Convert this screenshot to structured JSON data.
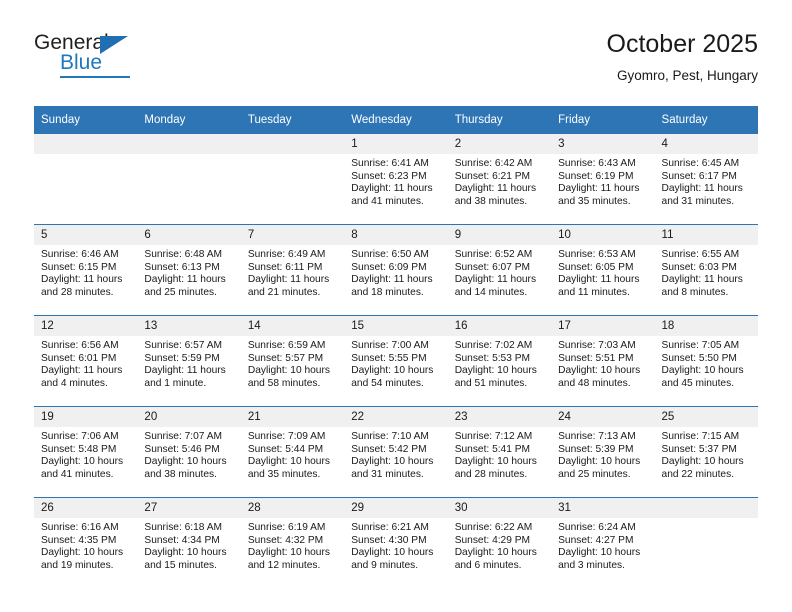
{
  "brand": {
    "name_top": "General",
    "name_bottom": "Blue",
    "accent_color": "#1f78bd",
    "triangle_color": "#1f6fb2"
  },
  "header": {
    "title": "October 2025",
    "location": "Gyomro, Pest, Hungary",
    "header_bg": "#2e75b6",
    "daynum_bg": "#f0f0f0"
  },
  "weekday_headers": [
    "Sunday",
    "Monday",
    "Tuesday",
    "Wednesday",
    "Thursday",
    "Friday",
    "Saturday"
  ],
  "weeks": [
    [
      {
        "day": "",
        "sunrise": "",
        "sunset": "",
        "daylight1": "",
        "daylight2": ""
      },
      {
        "day": "",
        "sunrise": "",
        "sunset": "",
        "daylight1": "",
        "daylight2": ""
      },
      {
        "day": "",
        "sunrise": "",
        "sunset": "",
        "daylight1": "",
        "daylight2": ""
      },
      {
        "day": "1",
        "sunrise": "Sunrise: 6:41 AM",
        "sunset": "Sunset: 6:23 PM",
        "daylight1": "Daylight: 11 hours",
        "daylight2": "and 41 minutes."
      },
      {
        "day": "2",
        "sunrise": "Sunrise: 6:42 AM",
        "sunset": "Sunset: 6:21 PM",
        "daylight1": "Daylight: 11 hours",
        "daylight2": "and 38 minutes."
      },
      {
        "day": "3",
        "sunrise": "Sunrise: 6:43 AM",
        "sunset": "Sunset: 6:19 PM",
        "daylight1": "Daylight: 11 hours",
        "daylight2": "and 35 minutes."
      },
      {
        "day": "4",
        "sunrise": "Sunrise: 6:45 AM",
        "sunset": "Sunset: 6:17 PM",
        "daylight1": "Daylight: 11 hours",
        "daylight2": "and 31 minutes."
      }
    ],
    [
      {
        "day": "5",
        "sunrise": "Sunrise: 6:46 AM",
        "sunset": "Sunset: 6:15 PM",
        "daylight1": "Daylight: 11 hours",
        "daylight2": "and 28 minutes."
      },
      {
        "day": "6",
        "sunrise": "Sunrise: 6:48 AM",
        "sunset": "Sunset: 6:13 PM",
        "daylight1": "Daylight: 11 hours",
        "daylight2": "and 25 minutes."
      },
      {
        "day": "7",
        "sunrise": "Sunrise: 6:49 AM",
        "sunset": "Sunset: 6:11 PM",
        "daylight1": "Daylight: 11 hours",
        "daylight2": "and 21 minutes."
      },
      {
        "day": "8",
        "sunrise": "Sunrise: 6:50 AM",
        "sunset": "Sunset: 6:09 PM",
        "daylight1": "Daylight: 11 hours",
        "daylight2": "and 18 minutes."
      },
      {
        "day": "9",
        "sunrise": "Sunrise: 6:52 AM",
        "sunset": "Sunset: 6:07 PM",
        "daylight1": "Daylight: 11 hours",
        "daylight2": "and 14 minutes."
      },
      {
        "day": "10",
        "sunrise": "Sunrise: 6:53 AM",
        "sunset": "Sunset: 6:05 PM",
        "daylight1": "Daylight: 11 hours",
        "daylight2": "and 11 minutes."
      },
      {
        "day": "11",
        "sunrise": "Sunrise: 6:55 AM",
        "sunset": "Sunset: 6:03 PM",
        "daylight1": "Daylight: 11 hours",
        "daylight2": "and 8 minutes."
      }
    ],
    [
      {
        "day": "12",
        "sunrise": "Sunrise: 6:56 AM",
        "sunset": "Sunset: 6:01 PM",
        "daylight1": "Daylight: 11 hours",
        "daylight2": "and 4 minutes."
      },
      {
        "day": "13",
        "sunrise": "Sunrise: 6:57 AM",
        "sunset": "Sunset: 5:59 PM",
        "daylight1": "Daylight: 11 hours",
        "daylight2": "and 1 minute."
      },
      {
        "day": "14",
        "sunrise": "Sunrise: 6:59 AM",
        "sunset": "Sunset: 5:57 PM",
        "daylight1": "Daylight: 10 hours",
        "daylight2": "and 58 minutes."
      },
      {
        "day": "15",
        "sunrise": "Sunrise: 7:00 AM",
        "sunset": "Sunset: 5:55 PM",
        "daylight1": "Daylight: 10 hours",
        "daylight2": "and 54 minutes."
      },
      {
        "day": "16",
        "sunrise": "Sunrise: 7:02 AM",
        "sunset": "Sunset: 5:53 PM",
        "daylight1": "Daylight: 10 hours",
        "daylight2": "and 51 minutes."
      },
      {
        "day": "17",
        "sunrise": "Sunrise: 7:03 AM",
        "sunset": "Sunset: 5:51 PM",
        "daylight1": "Daylight: 10 hours",
        "daylight2": "and 48 minutes."
      },
      {
        "day": "18",
        "sunrise": "Sunrise: 7:05 AM",
        "sunset": "Sunset: 5:50 PM",
        "daylight1": "Daylight: 10 hours",
        "daylight2": "and 45 minutes."
      }
    ],
    [
      {
        "day": "19",
        "sunrise": "Sunrise: 7:06 AM",
        "sunset": "Sunset: 5:48 PM",
        "daylight1": "Daylight: 10 hours",
        "daylight2": "and 41 minutes."
      },
      {
        "day": "20",
        "sunrise": "Sunrise: 7:07 AM",
        "sunset": "Sunset: 5:46 PM",
        "daylight1": "Daylight: 10 hours",
        "daylight2": "and 38 minutes."
      },
      {
        "day": "21",
        "sunrise": "Sunrise: 7:09 AM",
        "sunset": "Sunset: 5:44 PM",
        "daylight1": "Daylight: 10 hours",
        "daylight2": "and 35 minutes."
      },
      {
        "day": "22",
        "sunrise": "Sunrise: 7:10 AM",
        "sunset": "Sunset: 5:42 PM",
        "daylight1": "Daylight: 10 hours",
        "daylight2": "and 31 minutes."
      },
      {
        "day": "23",
        "sunrise": "Sunrise: 7:12 AM",
        "sunset": "Sunset: 5:41 PM",
        "daylight1": "Daylight: 10 hours",
        "daylight2": "and 28 minutes."
      },
      {
        "day": "24",
        "sunrise": "Sunrise: 7:13 AM",
        "sunset": "Sunset: 5:39 PM",
        "daylight1": "Daylight: 10 hours",
        "daylight2": "and 25 minutes."
      },
      {
        "day": "25",
        "sunrise": "Sunrise: 7:15 AM",
        "sunset": "Sunset: 5:37 PM",
        "daylight1": "Daylight: 10 hours",
        "daylight2": "and 22 minutes."
      }
    ],
    [
      {
        "day": "26",
        "sunrise": "Sunrise: 6:16 AM",
        "sunset": "Sunset: 4:35 PM",
        "daylight1": "Daylight: 10 hours",
        "daylight2": "and 19 minutes."
      },
      {
        "day": "27",
        "sunrise": "Sunrise: 6:18 AM",
        "sunset": "Sunset: 4:34 PM",
        "daylight1": "Daylight: 10 hours",
        "daylight2": "and 15 minutes."
      },
      {
        "day": "28",
        "sunrise": "Sunrise: 6:19 AM",
        "sunset": "Sunset: 4:32 PM",
        "daylight1": "Daylight: 10 hours",
        "daylight2": "and 12 minutes."
      },
      {
        "day": "29",
        "sunrise": "Sunrise: 6:21 AM",
        "sunset": "Sunset: 4:30 PM",
        "daylight1": "Daylight: 10 hours",
        "daylight2": "and 9 minutes."
      },
      {
        "day": "30",
        "sunrise": "Sunrise: 6:22 AM",
        "sunset": "Sunset: 4:29 PM",
        "daylight1": "Daylight: 10 hours",
        "daylight2": "and 6 minutes."
      },
      {
        "day": "31",
        "sunrise": "Sunrise: 6:24 AM",
        "sunset": "Sunset: 4:27 PM",
        "daylight1": "Daylight: 10 hours",
        "daylight2": "and 3 minutes."
      },
      {
        "day": "",
        "sunrise": "",
        "sunset": "",
        "daylight1": "",
        "daylight2": ""
      }
    ]
  ]
}
